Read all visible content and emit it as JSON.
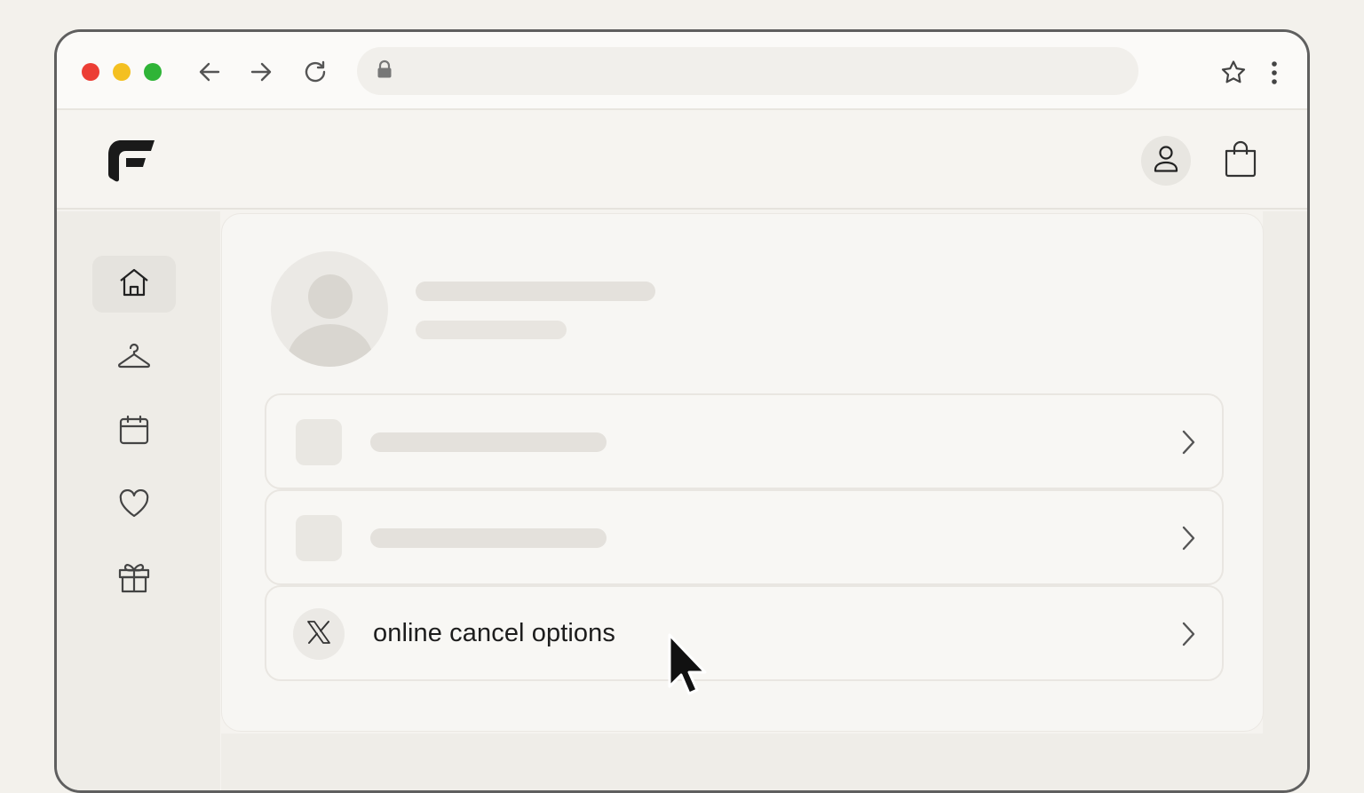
{
  "browser": {
    "traffic_lights": [
      "close",
      "minimize",
      "maximize"
    ],
    "nav_icons": [
      "back-icon",
      "forward-icon",
      "reload-icon"
    ],
    "address_icon": "lock-icon",
    "address_value": "",
    "right_icons": [
      "star-icon",
      "more-vertical-icon"
    ]
  },
  "header": {
    "logo_icon": "brand-f-logo",
    "account_icon": "user-icon",
    "bag_icon": "shopping-bag-icon"
  },
  "sidebar": {
    "items": [
      {
        "icon": "home-icon",
        "active": true
      },
      {
        "icon": "hanger-icon",
        "active": false
      },
      {
        "icon": "calendar-icon",
        "active": false
      },
      {
        "icon": "heart-icon",
        "active": false
      },
      {
        "icon": "gift-icon",
        "active": false
      }
    ]
  },
  "profile": {
    "avatar_icon": "avatar-placeholder",
    "name": "",
    "subtitle": ""
  },
  "list": {
    "rows": [
      {
        "icon": "placeholder-square",
        "label": ""
      },
      {
        "icon": "placeholder-square",
        "label": ""
      },
      {
        "icon": "x-icon",
        "label": "online cancel options"
      }
    ]
  },
  "colors": {
    "close": "#ec3e35",
    "minimize": "#f4c021",
    "maximize": "#2fb437",
    "text": "#1d1d1d"
  }
}
